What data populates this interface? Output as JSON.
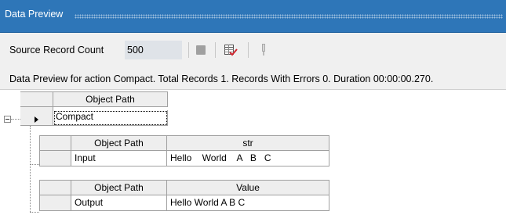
{
  "titlebar": {
    "title": "Data Preview"
  },
  "toolbar": {
    "source_record_count_label": "Source Record Count",
    "source_record_count_value": "500"
  },
  "status": {
    "message": "Data Preview for action Compact. Total Records 1. Records With Errors 0. Duration 00:00:00.270."
  },
  "grid": {
    "root": {
      "column_header": "Object Path",
      "row_value": "Compact"
    },
    "input_table": {
      "headers": [
        "Object Path",
        "str"
      ],
      "row": [
        "Input",
        "Hello    World    A   B   C"
      ]
    },
    "output_table": {
      "headers": [
        "Object Path",
        "Value"
      ],
      "row": [
        "Output",
        "Hello World A B C"
      ]
    }
  }
}
